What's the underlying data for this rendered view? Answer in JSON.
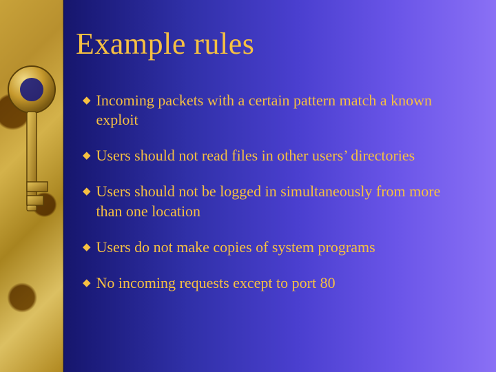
{
  "slide": {
    "title": "Example rules",
    "bullets": [
      "Incoming packets with a certain pattern match a known exploit",
      "Users should not read files in other users’ directories",
      "Users should not be logged in simultaneously from more than one location",
      "Users do not make copies of system programs",
      "No incoming requests except to port 80"
    ]
  }
}
